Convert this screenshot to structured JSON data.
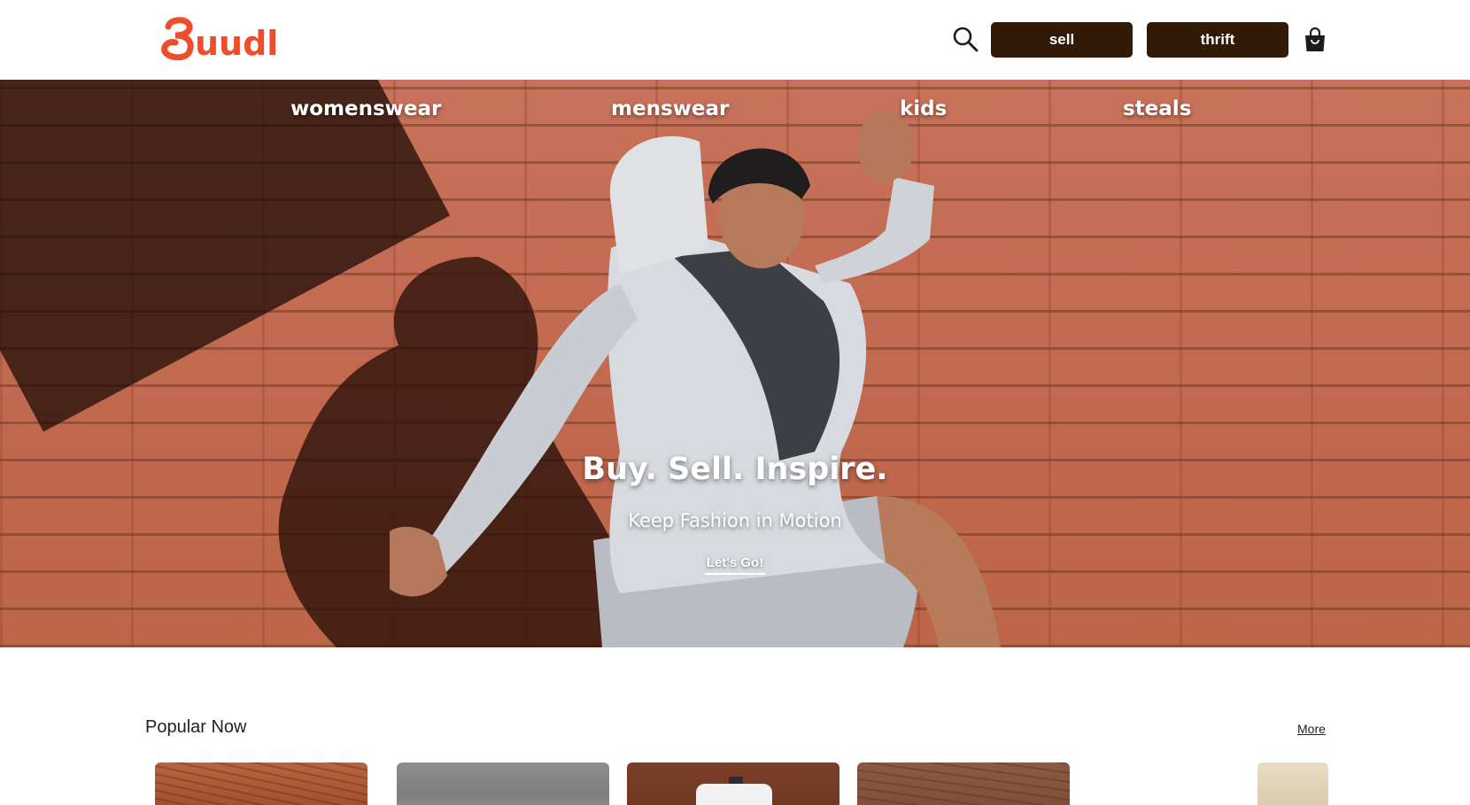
{
  "header": {
    "logo_text": "buudl",
    "search_icon": "search-icon",
    "sell_label": "sell",
    "thrift_label": "thrift",
    "bag_icon": "shopping-bag-icon",
    "brand_color": "#ee4e2c",
    "button_color": "#311b06"
  },
  "hero": {
    "nav": [
      "womenswear",
      "menswear",
      "kids",
      "steals"
    ],
    "title": "Buy. Sell. Inspire.",
    "subtitle": "Keep Fashion in Motion",
    "cta": "Let's Go!"
  },
  "popular": {
    "title": "Popular Now",
    "more": "More",
    "cards": [
      "product-card",
      "product-card",
      "product-card",
      "product-card",
      "product-card"
    ]
  }
}
